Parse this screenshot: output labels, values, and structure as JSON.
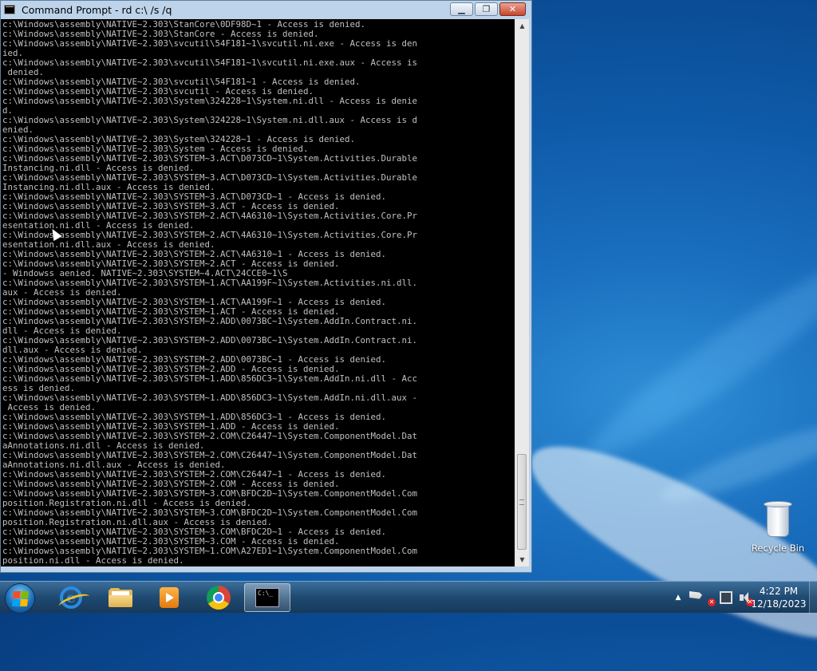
{
  "window": {
    "title": "Command Prompt - rd  c:\\ /s /q",
    "buttons": {
      "minimize": "▁",
      "maximize": "❐",
      "close": "✕"
    }
  },
  "console": {
    "lines": [
      "c:\\Windows\\assembly\\NATIVE~2.303\\StanCore\\0DF98D~1 - Access is denied.",
      "c:\\Windows\\assembly\\NATIVE~2.303\\StanCore - Access is denied.",
      "c:\\Windows\\assembly\\NATIVE~2.303\\svcutil\\54F181~1\\svcutil.ni.exe - Access is den",
      "ied.",
      "c:\\Windows\\assembly\\NATIVE~2.303\\svcutil\\54F181~1\\svcutil.ni.exe.aux - Access is",
      " denied.",
      "c:\\Windows\\assembly\\NATIVE~2.303\\svcutil\\54F181~1 - Access is denied.",
      "c:\\Windows\\assembly\\NATIVE~2.303\\svcutil - Access is denied.",
      "c:\\Windows\\assembly\\NATIVE~2.303\\System\\324228~1\\System.ni.dll - Access is denie",
      "d.",
      "c:\\Windows\\assembly\\NATIVE~2.303\\System\\324228~1\\System.ni.dll.aux - Access is d",
      "enied.",
      "c:\\Windows\\assembly\\NATIVE~2.303\\System\\324228~1 - Access is denied.",
      "c:\\Windows\\assembly\\NATIVE~2.303\\System - Access is denied.",
      "c:\\Windows\\assembly\\NATIVE~2.303\\SYSTEM~3.ACT\\D073CD~1\\System.Activities.Durable",
      "Instancing.ni.dll - Access is denied.",
      "c:\\Windows\\assembly\\NATIVE~2.303\\SYSTEM~3.ACT\\D073CD~1\\System.Activities.Durable",
      "Instancing.ni.dll.aux - Access is denied.",
      "c:\\Windows\\assembly\\NATIVE~2.303\\SYSTEM~3.ACT\\D073CD~1 - Access is denied.",
      "c:\\Windows\\assembly\\NATIVE~2.303\\SYSTEM~3.ACT - Access is denied.",
      "c:\\Windows\\assembly\\NATIVE~2.303\\SYSTEM~2.ACT\\4A6310~1\\System.Activities.Core.Pr",
      "esentation.ni.dll - Access is denied.",
      "c:\\Windows\\assembly\\NATIVE~2.303\\SYSTEM~2.ACT\\4A6310~1\\System.Activities.Core.Pr",
      "esentation.ni.dll.aux - Access is denied.",
      "c:\\Windows\\assembly\\NATIVE~2.303\\SYSTEM~2.ACT\\4A6310~1 - Access is denied.",
      "c:\\Windows\\assembly\\NATIVE~2.303\\SYSTEM~2.ACT - Access is denied.",
      "- Windowss aenied. NATIVE~2.303\\SYSTEM~4.ACT\\24CCE0~1\\S",
      "c:\\Windows\\assembly\\NATIVE~2.303\\SYSTEM~1.ACT\\AA199F~1\\System.Activities.ni.dll.",
      "aux - Access is denied.",
      "c:\\Windows\\assembly\\NATIVE~2.303\\SYSTEM~1.ACT\\AA199F~1 - Access is denied.",
      "c:\\Windows\\assembly\\NATIVE~2.303\\SYSTEM~1.ACT - Access is denied.",
      "c:\\Windows\\assembly\\NATIVE~2.303\\SYSTEM~2.ADD\\0073BC~1\\System.AddIn.Contract.ni.",
      "dll - Access is denied.",
      "c:\\Windows\\assembly\\NATIVE~2.303\\SYSTEM~2.ADD\\0073BC~1\\System.AddIn.Contract.ni.",
      "dll.aux - Access is denied.",
      "c:\\Windows\\assembly\\NATIVE~2.303\\SYSTEM~2.ADD\\0073BC~1 - Access is denied.",
      "c:\\Windows\\assembly\\NATIVE~2.303\\SYSTEM~2.ADD - Access is denied.",
      "c:\\Windows\\assembly\\NATIVE~2.303\\SYSTEM~1.ADD\\856DC3~1\\System.AddIn.ni.dll - Acc",
      "ess is denied.",
      "c:\\Windows\\assembly\\NATIVE~2.303\\SYSTEM~1.ADD\\856DC3~1\\System.AddIn.ni.dll.aux -",
      " Access is denied.",
      "c:\\Windows\\assembly\\NATIVE~2.303\\SYSTEM~1.ADD\\856DC3~1 - Access is denied.",
      "c:\\Windows\\assembly\\NATIVE~2.303\\SYSTEM~1.ADD - Access is denied.",
      "c:\\Windows\\assembly\\NATIVE~2.303\\SYSTEM~2.COM\\C26447~1\\System.ComponentModel.Dat",
      "aAnnotations.ni.dll - Access is denied.",
      "c:\\Windows\\assembly\\NATIVE~2.303\\SYSTEM~2.COM\\C26447~1\\System.ComponentModel.Dat",
      "aAnnotations.ni.dll.aux - Access is denied.",
      "c:\\Windows\\assembly\\NATIVE~2.303\\SYSTEM~2.COM\\C26447~1 - Access is denied.",
      "c:\\Windows\\assembly\\NATIVE~2.303\\SYSTEM~2.COM - Access is denied.",
      "c:\\Windows\\assembly\\NATIVE~2.303\\SYSTEM~3.COM\\BFDC2D~1\\System.ComponentModel.Com",
      "position.Registration.ni.dll - Access is denied.",
      "c:\\Windows\\assembly\\NATIVE~2.303\\SYSTEM~3.COM\\BFDC2D~1\\System.ComponentModel.Com",
      "position.Registration.ni.dll.aux - Access is denied.",
      "c:\\Windows\\assembly\\NATIVE~2.303\\SYSTEM~3.COM\\BFDC2D~1 - Access is denied.",
      "c:\\Windows\\assembly\\NATIVE~2.303\\SYSTEM~3.COM - Access is denied.",
      "c:\\Windows\\assembly\\NATIVE~2.303\\SYSTEM~1.COM\\A27ED1~1\\System.ComponentModel.Com",
      "position.ni.dll - Access is denied."
    ]
  },
  "scrollbar": {
    "up_arrow": "▲",
    "down_arrow": "▼"
  },
  "desktop": {
    "icons": [
      {
        "label": "Recycle Bin",
        "icon": "recycle-bin-icon"
      }
    ]
  },
  "taskbar": {
    "items": [
      {
        "name": "internet-explorer",
        "icon": "internet-explorer-icon",
        "glyph": "e"
      },
      {
        "name": "windows-explorer",
        "icon": "folder-icon"
      },
      {
        "name": "media-player",
        "icon": "media-player-icon"
      },
      {
        "name": "google-chrome",
        "icon": "chrome-icon"
      },
      {
        "name": "command-prompt",
        "icon": "cmd-icon",
        "glyph": "C:\\_"
      }
    ],
    "tray": {
      "show_hidden": "▲"
    },
    "clock": {
      "time": "4:22 PM",
      "date": "12/18/2023"
    }
  }
}
